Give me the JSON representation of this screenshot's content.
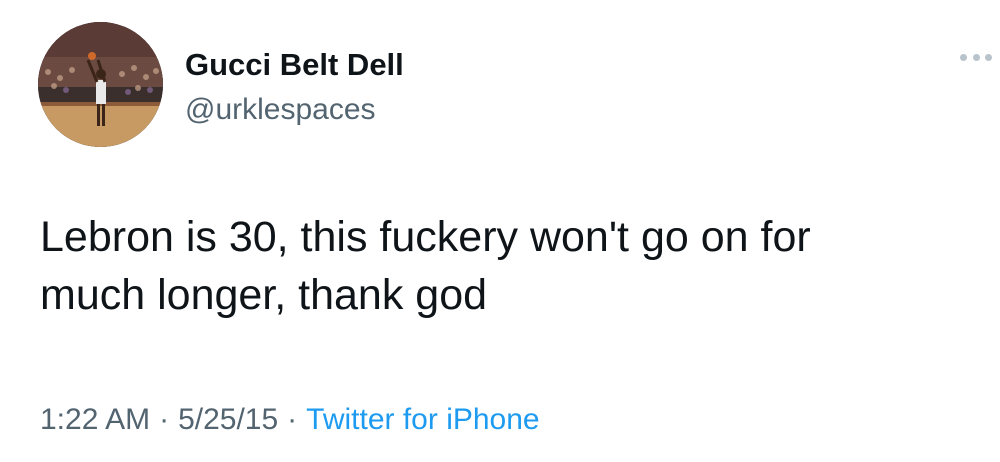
{
  "user": {
    "display_name": "Gucci Belt Dell",
    "handle": "@urklespaces",
    "avatar_description_icon": "basketball-player-avatar"
  },
  "more_icon": "more-options-icon",
  "tweet": {
    "text": "Lebron is 30, this fuckery won't go on for\nmuch longer, thank god"
  },
  "meta": {
    "time": "1:22 AM",
    "separator": "·",
    "date": "5/25/15",
    "source": "Twitter for iPhone"
  },
  "colors": {
    "text": "#0f1419",
    "secondary": "#536471",
    "link": "#1d9bf0"
  }
}
